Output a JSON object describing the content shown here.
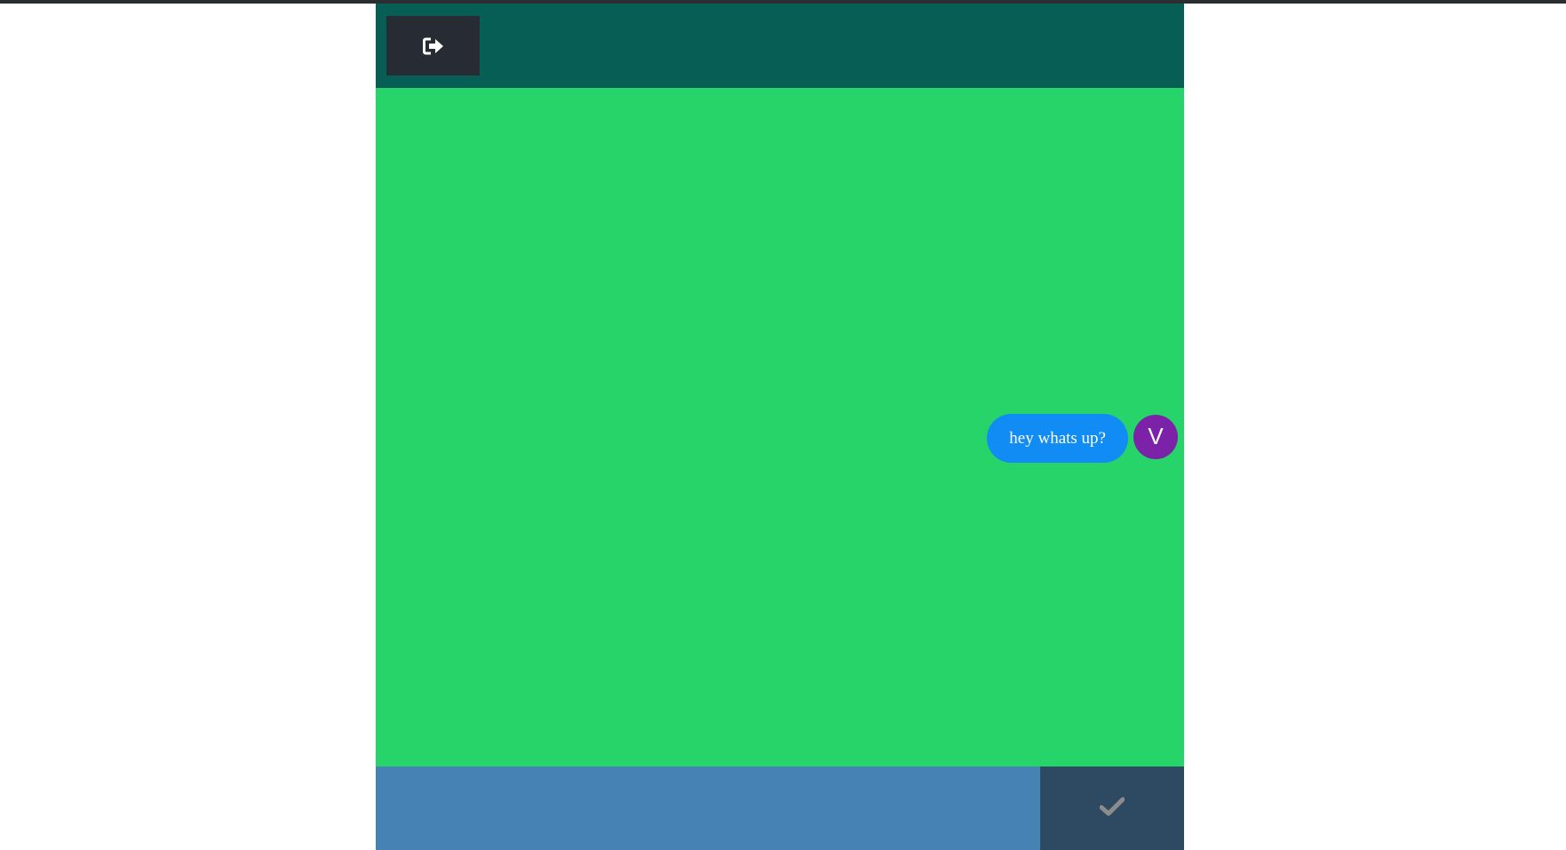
{
  "header": {
    "logout_icon": "sign-out-icon"
  },
  "messages": [
    {
      "text": "hey whats up?",
      "avatar_initial": "V"
    }
  ],
  "composer": {
    "input_value": "",
    "input_placeholder": "",
    "send_icon": "check-icon"
  },
  "colors": {
    "header_bg": "#065e55",
    "logout_button_bg": "#272b33",
    "chat_bg": "#27d469",
    "bubble_bg": "#118cf4",
    "avatar_bg": "#7b22a8",
    "input_bg": "#4682b4",
    "send_button_bg": "#2e4a62"
  }
}
